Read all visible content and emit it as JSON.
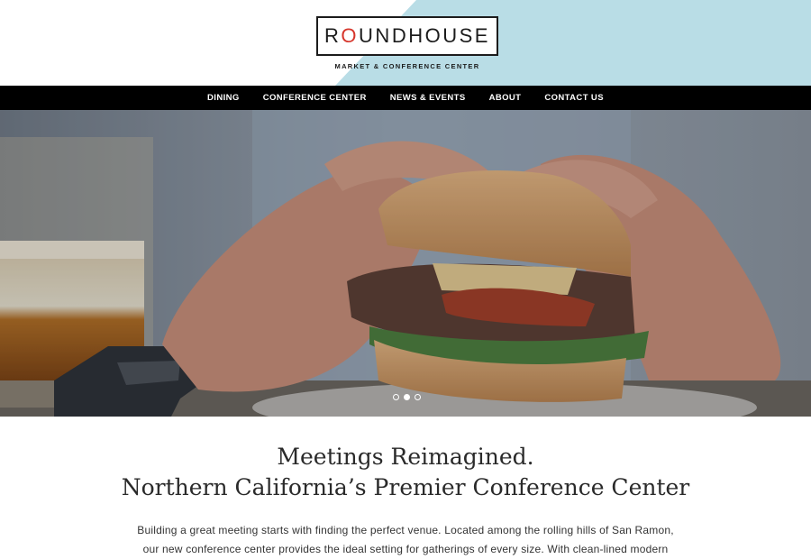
{
  "header": {
    "logo": {
      "prefix": "R",
      "accent": "O",
      "rest": "UNDHOUSE",
      "subtitle": "MARKET & CONFERENCE CENTER"
    }
  },
  "nav": {
    "items": [
      {
        "label": "DINING"
      },
      {
        "label": "CONFERENCE CENTER"
      },
      {
        "label": "NEWS & EVENTS"
      },
      {
        "label": "ABOUT"
      },
      {
        "label": "CONTACT US"
      }
    ]
  },
  "hero": {
    "slides_total": 3,
    "active_slide": 2
  },
  "content": {
    "headline_1": "Meetings Reimagined.",
    "headline_2": "Northern California’s Premier Conference Center",
    "body_line_1": "Building a great meeting starts with finding the perfect venue. Located among the rolling hills of San Ramon,",
    "body_line_2": "our new conference center provides the ideal setting for gatherings of every size. With clean-lined modern"
  },
  "colors": {
    "accent_red": "#d6352b",
    "header_blue": "#b9dde6",
    "nav_black": "#000000",
    "text_dark": "#2a2a2a"
  }
}
